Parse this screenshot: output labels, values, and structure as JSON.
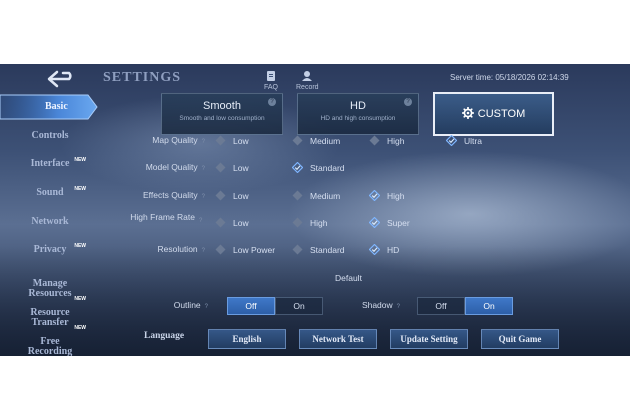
{
  "header": {
    "title": "SETTINGS",
    "faq_label": "FAQ",
    "record_label": "Record",
    "server_time": "Server time: 05/18/2026 02:14:39"
  },
  "sidebar": {
    "items": [
      {
        "label": "Basic",
        "selected": true
      },
      {
        "label": "Controls"
      },
      {
        "label": "Interface",
        "badge": "NEW"
      },
      {
        "label": "Sound",
        "badge": "NEW"
      },
      {
        "label": "Network"
      },
      {
        "label": "Privacy",
        "badge": "NEW"
      },
      {
        "label": "Manage\nResources"
      },
      {
        "label": "Resource\nTransfer",
        "badge": "NEW"
      },
      {
        "label": "Free\nRecording",
        "badge": "NEW"
      }
    ]
  },
  "presets": {
    "smooth": {
      "title": "Smooth",
      "subtitle": "Smooth and low consumption"
    },
    "hd": {
      "title": "HD",
      "subtitle": "HD and high consumption"
    },
    "custom": {
      "title": "CUSTOM",
      "selected": true
    }
  },
  "settings": [
    {
      "label": "Map Quality",
      "options": [
        "Low",
        "Medium",
        "High",
        "Ultra"
      ],
      "selected": "Ultra"
    },
    {
      "label": "Model Quality",
      "options": [
        "Low",
        "Standard"
      ],
      "selected": "Standard"
    },
    {
      "label": "Effects Quality",
      "options": [
        "Low",
        "Medium",
        "High"
      ],
      "selected": "High"
    },
    {
      "label": "High Frame Rate",
      "options": [
        "Low",
        "High",
        "Super"
      ],
      "selected": "Super"
    },
    {
      "label": "Resolution",
      "options": [
        "Low Power",
        "Standard",
        "HD"
      ],
      "selected": "HD"
    }
  ],
  "default_label": "Default",
  "outline": {
    "label": "Outline",
    "off": "Off",
    "on": "On",
    "value": "Off"
  },
  "shadow": {
    "label": "Shadow",
    "off": "Off",
    "on": "On",
    "value": "On"
  },
  "bottom": {
    "language_label": "Language",
    "language_value": "English",
    "network_test": "Network Test",
    "update_setting": "Update Setting",
    "quit_game": "Quit Game"
  },
  "colors": {
    "accent": "#3f78c8",
    "selected_diamond": "#7fb6ff",
    "unselected_diamond": "#6b7a94"
  }
}
